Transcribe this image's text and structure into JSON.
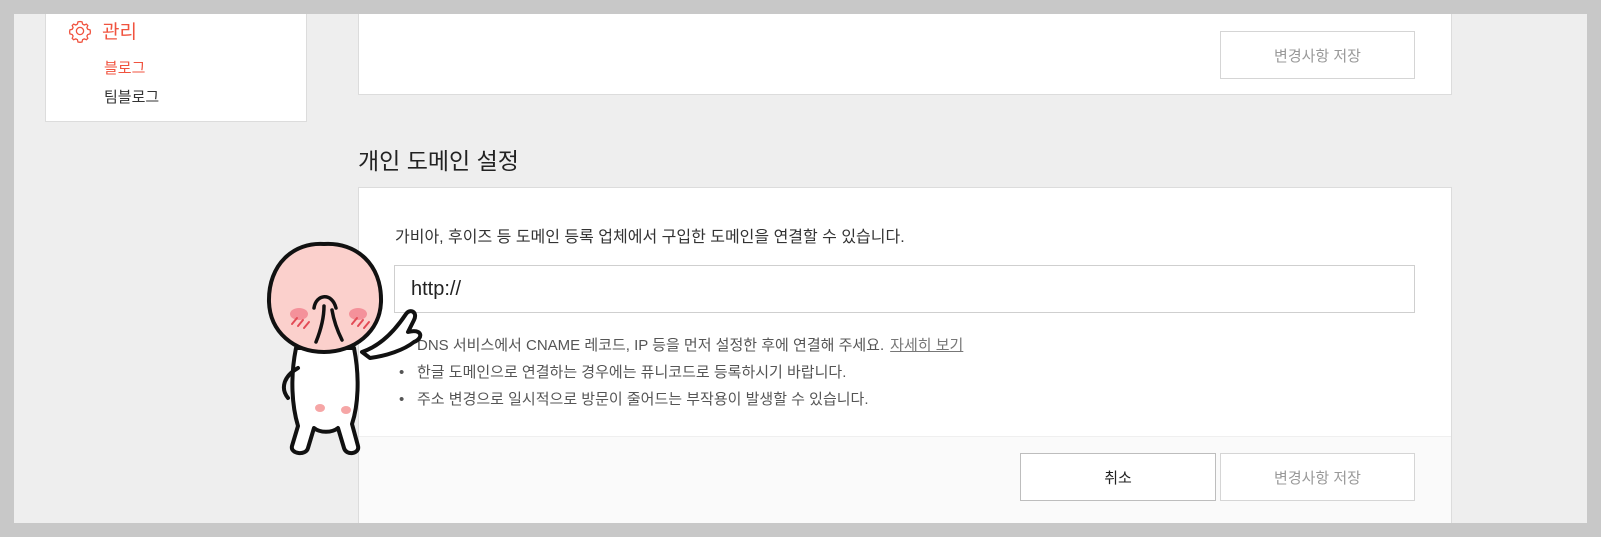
{
  "sidebar": {
    "title": "관리",
    "items": [
      {
        "label": "블로그",
        "active": true
      },
      {
        "label": "팀블로그",
        "active": false
      }
    ],
    "icon": "gear-icon",
    "accent_color": "#f0533f"
  },
  "top_panel": {
    "save_label": "변경사항 저장"
  },
  "domain_section": {
    "title": "개인 도메인 설정",
    "description": "가비아, 후이즈 등 도메인 등록 업체에서 구입한 도메인을 연결할 수 있습니다.",
    "input_placeholder": "http://",
    "input_value": "",
    "notes": [
      {
        "text": "DNS 서비스에서 CNAME 레코드, IP 등을 먼저 설정한 후에 연결해 주세요.",
        "link": "자세히 보기"
      },
      {
        "text": "한글 도메인으로 연결하는 경우에는 퓨니코드로 등록하시기 바랍니다."
      },
      {
        "text": "주소 변경으로 일시적으로 방문이 줄어드는 부작용이 발생할 수 있습니다."
      }
    ],
    "cancel_label": "취소",
    "save_label": "변경사항 저장"
  }
}
